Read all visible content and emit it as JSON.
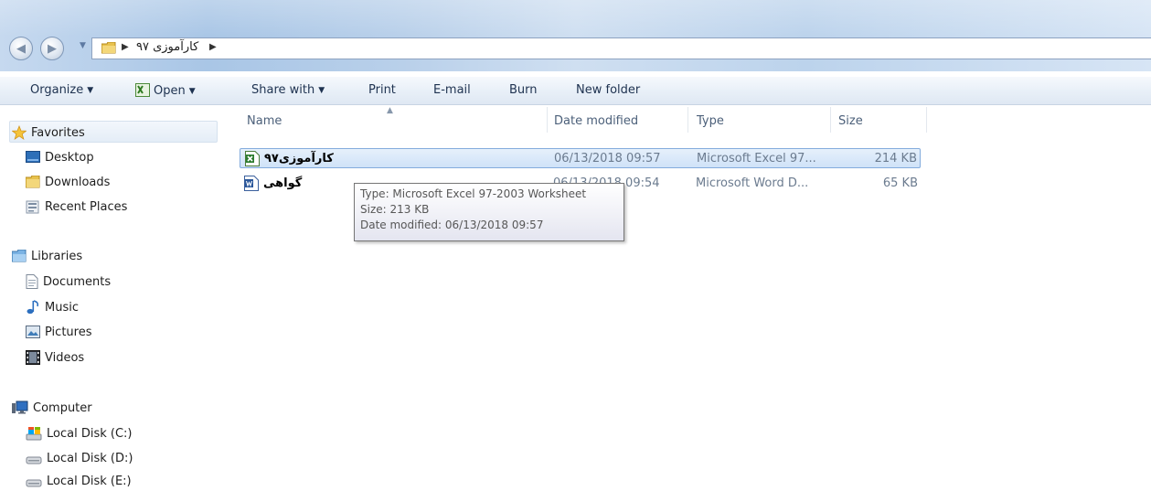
{
  "address": {
    "crumb": "کارآموزی ۹۷"
  },
  "toolbar": {
    "organize": "Organize",
    "open": "Open",
    "share_with": "Share with",
    "print": "Print",
    "email": "E-mail",
    "burn": "Burn",
    "new_folder": "New folder"
  },
  "sidebar": {
    "favorites": "Favorites",
    "desktop": "Desktop",
    "downloads": "Downloads",
    "recent_places": "Recent Places",
    "libraries": "Libraries",
    "documents": "Documents",
    "music": "Music",
    "pictures": "Pictures",
    "videos": "Videos",
    "computer": "Computer",
    "disk_c": "Local Disk (C:)",
    "disk_d": "Local Disk (D:)",
    "disk_e": "Local Disk (E:)"
  },
  "columns": {
    "name": "Name",
    "date_modified": "Date modified",
    "type": "Type",
    "size": "Size"
  },
  "files": [
    {
      "name": "کارآموزی۹۷",
      "date": "06/13/2018 09:57",
      "type": "Microsoft Excel 97...",
      "size": "214 KB",
      "icon": "excel-file-icon"
    },
    {
      "name": "گواهی",
      "date": "06/13/2018 09:54",
      "type": "Microsoft Word D...",
      "size": "65 KB",
      "icon": "word-file-icon"
    }
  ],
  "tooltip": {
    "type": "Type: Microsoft Excel 97-2003 Worksheet",
    "size": "Size: 213 KB",
    "date": "Date modified: 06/13/2018 09:57"
  }
}
